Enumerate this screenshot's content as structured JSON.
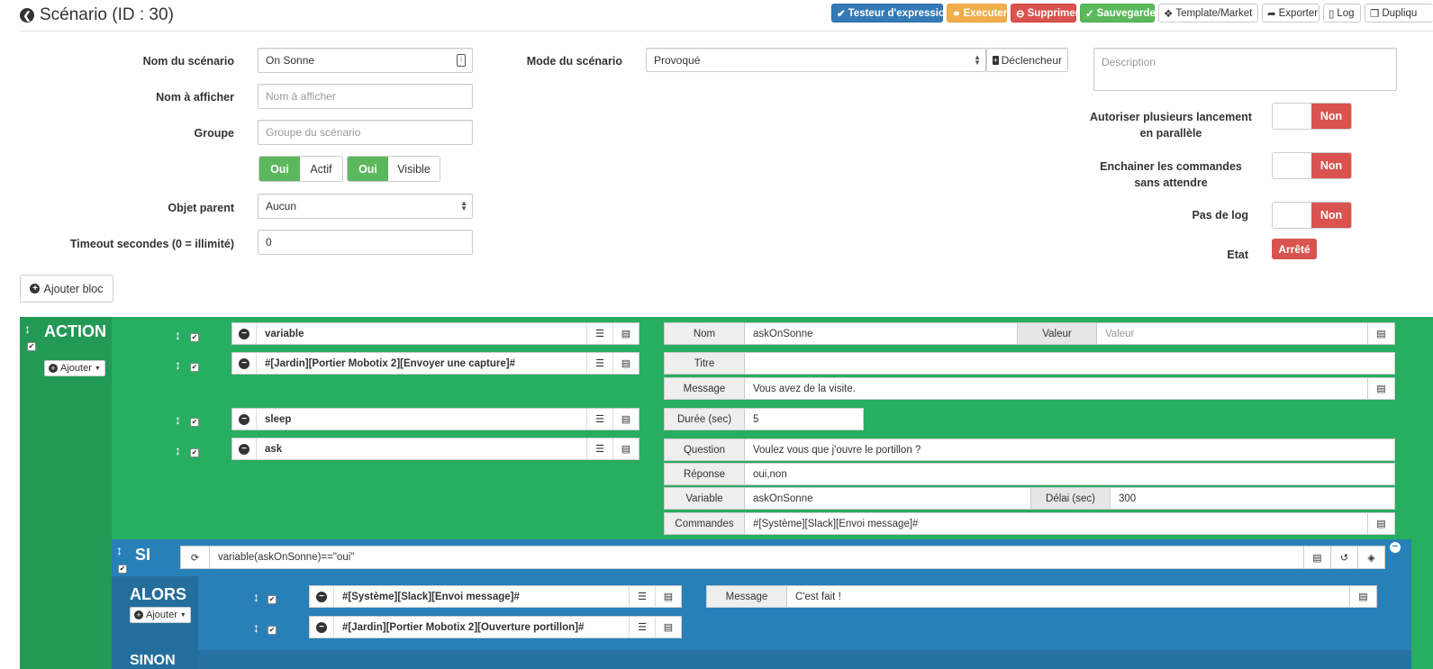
{
  "header": {
    "title": "Scénario (ID : 30)",
    "buttons": {
      "testeur": "Testeur d'expression",
      "executer": "Executer",
      "supprimer": "Supprimer",
      "sauvegarder": "Sauvegarder",
      "template": "Template/Market",
      "exporter": "Exporter",
      "log": "Log",
      "dupliquer": "Dupliqu"
    }
  },
  "form": {
    "nom_label": "Nom du scénario",
    "nom_value": "On Sonne",
    "afficher_label": "Nom à afficher",
    "afficher_placeholder": "Nom à afficher",
    "groupe_label": "Groupe",
    "groupe_placeholder": "Groupe du scénario",
    "actif_on": "Oui",
    "actif_label": "Actif",
    "visible_on": "Oui",
    "visible_label": "Visible",
    "parent_label": "Objet parent",
    "parent_value": "Aucun",
    "timeout_label": "Timeout secondes (0 = illimité)",
    "timeout_value": "0",
    "mode_label": "Mode du scénario",
    "mode_value": "Provoqué",
    "declencheur": "Déclencheur",
    "description_placeholder": "Description",
    "parallel_label_1": "Autoriser plusieurs lancement",
    "parallel_label_2": "en parallèle",
    "parallel_value": "Non",
    "enchainer_label_1": "Enchainer les commandes",
    "enchainer_label_2": "sans attendre",
    "enchainer_value": "Non",
    "pasdelog_label": "Pas de log",
    "pasdelog_value": "Non",
    "etat_label": "Etat",
    "etat_value": "Arrêté",
    "ajouter_bloc": "Ajouter bloc"
  },
  "action_block": {
    "title": "ACTION",
    "ajouter": "Ajouter",
    "rows": [
      {
        "cmd": "variable"
      },
      {
        "cmd": "#[Jardin][Portier Mobotix 2][Envoyer une capture]#"
      },
      {
        "cmd": "sleep"
      },
      {
        "cmd": "ask"
      }
    ],
    "fields": {
      "nom_k": "Nom",
      "nom_v": "askOnSonne",
      "valeur_k": "Valeur",
      "valeur_ph": "Valeur",
      "titre_k": "Titre",
      "titre_v": "",
      "message_k": "Message",
      "message_v": "Vous avez de la visite.",
      "duree_k": "Durée (sec)",
      "duree_v": "5",
      "question_k": "Question",
      "question_v": "Voulez vous que j'ouvre le portillon ?",
      "reponse_k": "Réponse",
      "reponse_v": "oui,non",
      "variable_k": "Variable",
      "variable_v": "askOnSonne",
      "delai_k": "Délai (sec)",
      "delai_v": "300",
      "commandes_k": "Commandes",
      "commandes_v": "#[Système][Slack][Envoi message]#"
    }
  },
  "si_block": {
    "title": "SI",
    "condition": "variable(askOnSonne)==\"oui\"",
    "alors": "ALORS",
    "ajouter": "Ajouter",
    "rows": [
      {
        "cmd": "#[Système][Slack][Envoi message]#"
      },
      {
        "cmd": "#[Jardin][Portier Mobotix 2][Ouverture portillon]#"
      }
    ],
    "message_k": "Message",
    "message_v": "C'est fait !",
    "sinon": "SINON"
  }
}
